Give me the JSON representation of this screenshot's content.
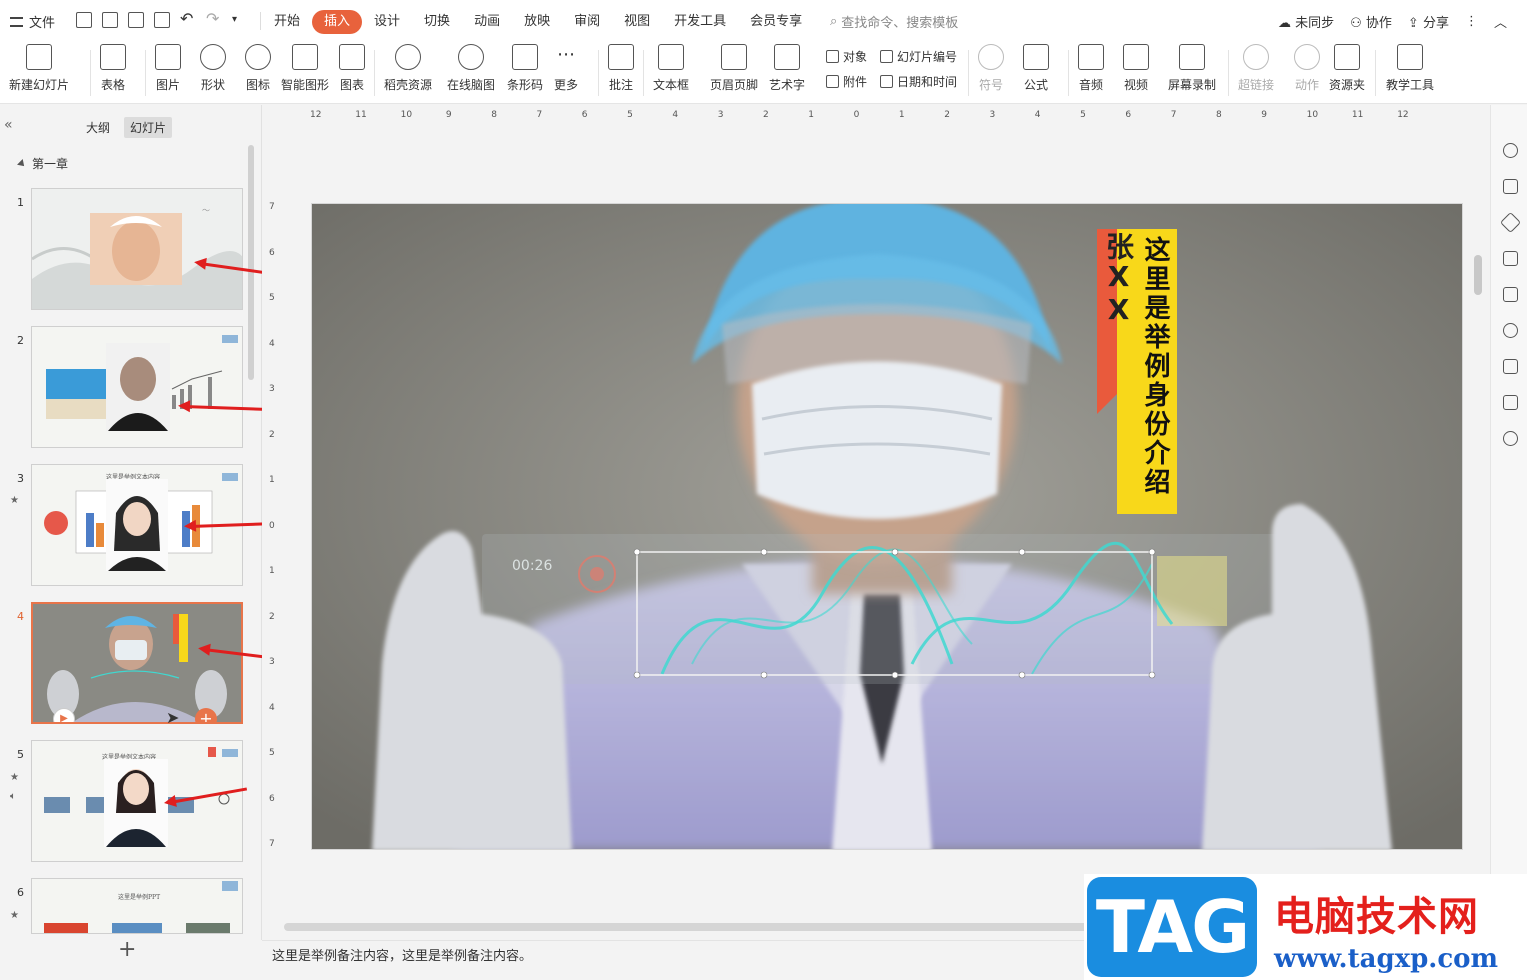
{
  "menubar": {
    "file_label": "文件",
    "tabs": [
      "开始",
      "插入",
      "设计",
      "切换",
      "动画",
      "放映",
      "审阅",
      "视图",
      "开发工具",
      "会员专享"
    ],
    "active_tab": "插入",
    "search_placeholder": "查找命令、搜索模板",
    "right": {
      "sync": "未同步",
      "collab": "协作",
      "share": "分享"
    }
  },
  "ribbon": {
    "new_slide": "新建幻灯片",
    "table": "表格",
    "picture": "图片",
    "shape": "形状",
    "icon": "图标",
    "smart_shape": "智能图形",
    "chart": "图表",
    "docer": "稻壳资源",
    "mindmap": "在线脑图",
    "barcode": "条形码",
    "more": "更多",
    "comment": "批注",
    "textbox": "文本框",
    "header_footer": "页眉页脚",
    "wordart": "艺术字",
    "object": "对象",
    "attachment": "附件",
    "slide_number": "幻灯片编号",
    "datetime": "日期和时间",
    "symbol": "符号",
    "formula": "公式",
    "audio": "音频",
    "video": "视频",
    "screen_record": "屏幕录制",
    "hyperlink": "超链接",
    "action": "动作",
    "resources": "资源夹",
    "teaching_tools": "教学工具"
  },
  "leftpanel": {
    "tab_outline": "大纲",
    "tab_slides": "幻灯片",
    "section": "第一章",
    "slides": [
      {
        "num": "1",
        "star": ""
      },
      {
        "num": "2",
        "star": ""
      },
      {
        "num": "3",
        "star": "★",
        "title": "这里是举例文本内容"
      },
      {
        "num": "4",
        "star": ""
      },
      {
        "num": "5",
        "star": "★",
        "title": "这里是举例文本内容"
      },
      {
        "num": "6",
        "star": "★",
        "title": "这里是举例PPT"
      }
    ],
    "active_slide": "4"
  },
  "ruler": {
    "h": [
      "12",
      "11",
      "10",
      "9",
      "8",
      "7",
      "6",
      "5",
      "4",
      "3",
      "2",
      "1",
      "0",
      "1",
      "2",
      "3",
      "4",
      "5",
      "6",
      "7",
      "8",
      "9",
      "10",
      "11",
      "12"
    ],
    "v": [
      "7",
      "6",
      "5",
      "4",
      "3",
      "2",
      "1",
      "0",
      "1",
      "2",
      "3",
      "4",
      "5",
      "6",
      "7"
    ]
  },
  "slide": {
    "name_text": "张XX",
    "intro_text": "这里是举例身份介绍",
    "hud_time": "00:26",
    "colors": {
      "yellow": "#f8d81a",
      "ribbon_red": "#e95a3c",
      "hud_teal": "#40d8d0"
    }
  },
  "notes": {
    "text": "这里是举例备注内容，这里是举例备注内容。"
  },
  "watermark": {
    "tag": "TAG",
    "cn": "电脑技术网",
    "url": "www.tagxp.com"
  }
}
